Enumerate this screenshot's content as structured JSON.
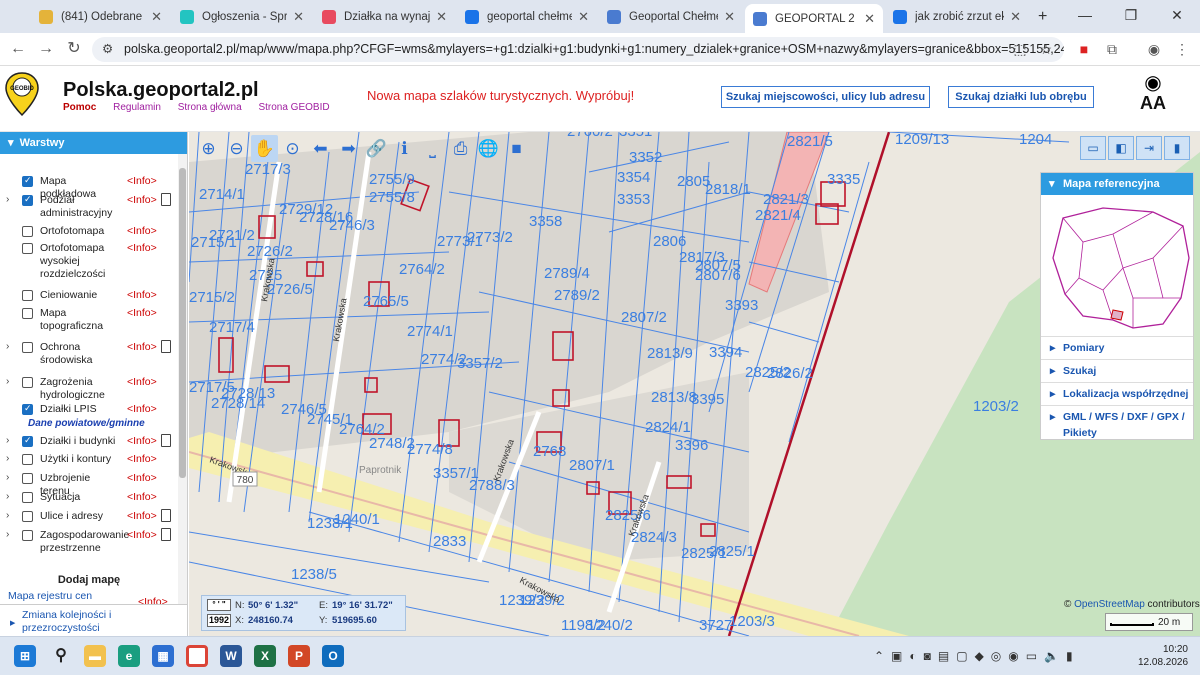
{
  "browser": {
    "tabs": [
      {
        "title": "(841) Odebrane - Lista",
        "color": "#e4b33a"
      },
      {
        "title": "Ogłoszenia - Sprzedaj",
        "color": "#23c4c1"
      },
      {
        "title": "Działka na wynajem",
        "color": "#e84a5f"
      },
      {
        "title": "geoportal chełmek -",
        "color": "#1a73e8"
      },
      {
        "title": "Geoportal Chełmek |",
        "color": "#4a7bd0"
      },
      {
        "title": "GEOPORTAL 2",
        "color": "#4a7bd0"
      },
      {
        "title": "jak zrobić zrzut ekranu",
        "color": "#1a73e8"
      }
    ],
    "active_tab": 5,
    "new_tab": "+",
    "url": "polska.geoportal2.pl/map/www/mapa.php?CFGF=wms&mylayers=+g1:dzialki+g1:budynki+g1:numery_dzialek+granice+OSM+nazwy&mylayers=granice&bbox=515155,242151,5..."
  },
  "header": {
    "site_title": "Polska.geoportal2.pl",
    "links": {
      "help": "Pomoc",
      "terms": "Regulamin",
      "home": "Strona główna",
      "geobid": "Strona GEOBID"
    },
    "promo": "Nowa mapa szlaków turystycznych. Wypróbuj!",
    "search_address_btn": "Szukaj miejscowości, ulicy lub adresu",
    "search_parcel_btn": "Szukaj działki lub obrębu",
    "logo_text": "GEOBID",
    "font_size_label": "AA"
  },
  "sidebar": {
    "title": "Warstwy",
    "info_label": "<Info>",
    "layers": [
      {
        "name": "Mapa podkładowa",
        "checked": true,
        "expand": false,
        "doc": false
      },
      {
        "name": "Podział administracyjny",
        "checked": true,
        "expand": true,
        "doc": true
      },
      {
        "name": "Ortofotomapa",
        "checked": false,
        "expand": false,
        "doc": false
      },
      {
        "name": "Ortofotomapa wysokiej rozdzielczości",
        "checked": false,
        "expand": false,
        "doc": false
      },
      {
        "name": "Cieniowanie",
        "checked": false,
        "expand": false,
        "doc": false
      },
      {
        "name": "Mapa topograficzna",
        "checked": false,
        "expand": false,
        "doc": false
      },
      {
        "name": "Ochrona środowiska",
        "checked": false,
        "expand": true,
        "doc": true
      },
      {
        "name": "Zagrożenia hydrologiczne",
        "checked": false,
        "expand": true,
        "doc": false
      },
      {
        "name": "Działki LPIS",
        "checked": true,
        "expand": false,
        "doc": false
      },
      {
        "name": "Działki i budynki",
        "checked": true,
        "expand": true,
        "doc": true
      },
      {
        "name": "Użytki i kontury",
        "checked": false,
        "expand": true,
        "doc": false
      },
      {
        "name": "Uzbrojenie terenu",
        "checked": false,
        "expand": true,
        "doc": false
      },
      {
        "name": "Sytuacja",
        "checked": false,
        "expand": true,
        "doc": false
      },
      {
        "name": "Ulice i adresy",
        "checked": false,
        "expand": true,
        "doc": true
      },
      {
        "name": "Zagospodarowanie przestrzenne",
        "checked": false,
        "expand": true,
        "doc": true
      }
    ],
    "section_dane": "Dane powiatowe/gminne",
    "add_map": "Dodaj mapę",
    "map_registry": "Mapa rejestru cen",
    "reorder": "Zmiana kolejności i przezroczystości"
  },
  "map": {
    "parcel_labels": [
      "2717/3",
      "2755/9",
      "2714/1",
      "2755/8",
      "2729/12",
      "2728/16",
      "2746/3",
      "2721/2",
      "2715/1",
      "2726/2",
      "2773/1",
      "2773/2",
      "3358",
      "2764/2",
      "2789/4",
      "2789/2",
      "2725",
      "2726/5",
      "2765/5",
      "2715/2",
      "2717/4",
      "2774/1",
      "2807/2",
      "2774/2",
      "3357/2",
      "2813/9",
      "2717/5",
      "2728/13",
      "2728/14",
      "2746/5",
      "2745/1",
      "2764/2",
      "2748/2",
      "2774/8",
      "2813/8",
      "2824/1",
      "2768",
      "2807/1",
      "3357/1",
      "2788/3",
      "2825/6",
      "2824/3",
      "2825/1",
      "2825/1",
      "1238/1",
      "1240/1",
      "2833",
      "1238/5",
      "1239/2",
      "1239/2",
      "1198/2",
      "1240/2",
      "3727",
      "1203/3",
      "1203/2",
      "2760/2",
      "3351",
      "3352",
      "3354",
      "2805",
      "2818/1",
      "2821/5",
      "1209/13",
      "1204",
      "3335",
      "3353",
      "2821/3",
      "2821/4",
      "2806",
      "2817/3",
      "2807/6",
      "2807/5",
      "3393",
      "3394",
      "2825/2",
      "2826/2",
      "3395",
      "3396"
    ],
    "street_labels": [
      "Krakowska",
      "Krakowska",
      "Krakowska",
      "Krakowska",
      "Krakowska",
      "Krakowska"
    ],
    "road_number": "780",
    "locality": "Paprotnik"
  },
  "toolbar": [
    "zoom-in",
    "zoom-out",
    "pan",
    "zoom-box",
    "back",
    "forward",
    "link",
    "info",
    "measure",
    "print",
    "globe",
    "camera"
  ],
  "right_panel": {
    "title": "Mapa referencyjna",
    "items": [
      "Pomiary",
      "Szukaj",
      "Lokalizacja współrzędnej",
      "GML / WFS / DXF / GPX / Pikiety"
    ]
  },
  "coords": {
    "format_btn": "° ' \"",
    "system": "1992",
    "n_label": "N:",
    "n": "50° 6' 1.32\"",
    "e_label": "E:",
    "e": "19° 16' 31.72\"",
    "x_label": "X:",
    "x": "248160.74",
    "y_label": "Y:",
    "y": "519695.60"
  },
  "attribution": {
    "prefix": "©",
    "link": "OpenStreetMap",
    "suffix": "contributors"
  },
  "scale": "20 m",
  "taskbar": {
    "time": "10:20",
    "date": "12.08.2026"
  }
}
